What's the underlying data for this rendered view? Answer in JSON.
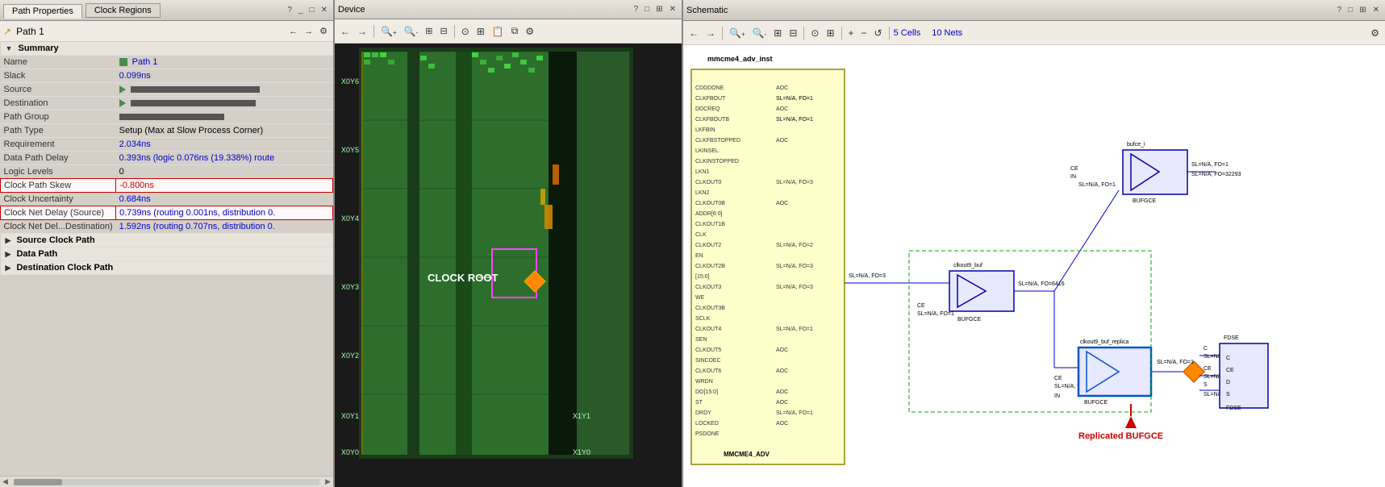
{
  "left_panel": {
    "tab_active": "Path Properties",
    "tab_inactive": "Clock Regions",
    "path_title": "Path 1",
    "toolbar": {
      "back_label": "←",
      "forward_label": "→",
      "settings_label": "⚙"
    },
    "summary_header": "Summary",
    "properties": [
      {
        "key": "Name",
        "value": "Path 1",
        "style": "blue",
        "has_icon": true,
        "highlight": false
      },
      {
        "key": "Slack",
        "value": "0.099ns",
        "style": "blue",
        "highlight": false
      },
      {
        "key": "Source",
        "value": "",
        "style": "bar",
        "highlight": false
      },
      {
        "key": "Destination",
        "value": "",
        "style": "bar",
        "highlight": false
      },
      {
        "key": "Path Group",
        "value": "",
        "style": "bar",
        "highlight": false
      },
      {
        "key": "Path Type",
        "value": "Setup (Max at Slow Process Corner)",
        "style": "black",
        "highlight": false
      },
      {
        "key": "Requirement",
        "value": "2.034ns",
        "style": "blue",
        "highlight": false
      },
      {
        "key": "Data Path Delay",
        "value": "0.393ns (logic 0.076ns (19.338%)  route",
        "style": "blue",
        "highlight": false
      },
      {
        "key": "Logic Levels",
        "value": "0",
        "style": "black",
        "highlight": false
      },
      {
        "key": "Clock Path Skew",
        "value": "-0.800ns",
        "style": "red",
        "highlight": true
      },
      {
        "key": "Clock Uncertainty",
        "value": "0.684ns",
        "style": "blue",
        "highlight": false
      },
      {
        "key": "Clock Net Delay (Source)",
        "value": "0.739ns (routing 0.001ns, distribution 0.",
        "style": "blue",
        "highlight": true
      },
      {
        "key": "Clock Net Del...Destination)",
        "value": "1.592ns (routing 0.707ns, distribution 0.",
        "style": "blue",
        "highlight": false
      }
    ],
    "sections": [
      {
        "label": "Source Clock Path",
        "expanded": false
      },
      {
        "label": "Data Path",
        "expanded": false
      },
      {
        "label": "Destination Clock Path",
        "expanded": false
      }
    ]
  },
  "middle_panel": {
    "title": "Device",
    "toolbar_buttons": [
      "←",
      "→",
      "🔍+",
      "🔍-",
      "⊞",
      "⊟",
      "⊙",
      "⊞",
      "📋",
      "⧉",
      "⚙"
    ],
    "clock_root_label": "CLOCK ROOT",
    "coord_labels": [
      "X0Y6",
      "X0Y5",
      "X0Y4",
      "X0Y3",
      "X0Y2",
      "X0Y1",
      "X0Y0",
      "X1Y1",
      "X1Y0"
    ]
  },
  "right_panel": {
    "title": "Schematic",
    "cell_count": "5 Cells",
    "net_count": "10 Nets",
    "toolbar_buttons": [
      "←",
      "→",
      "🔍+",
      "🔍-",
      "⊞",
      "⊟",
      "⊙",
      "⊞",
      "+",
      "-",
      "↺"
    ],
    "components": {
      "mmcme4_label": "mmcme4_adv_inst",
      "mmcme4_type": "MMCME4_ADV",
      "bufgce1_label": "clkout9_buf",
      "bufgce1_type": "BUFGCE",
      "bufgce2_label": "bufce_i",
      "bufgce2_type": "BUFGCE",
      "bufgce3_label": "clkout9_buf_replica",
      "bufgce3_type": "BUFGCE",
      "fdse_type": "FDSE",
      "replicated_label": "Replicated BUFGCE"
    },
    "mmcme4_ports_left": [
      "CDDDONE",
      "CLKFBOUT",
      "DDCREQ",
      "CLKFBOUTB",
      "LKFBIN",
      "CLKFBSTOPPED",
      "LKINSEL",
      "CLKINSTOPPED",
      "LKN1",
      "CLKOUT0",
      "LKN2",
      "CLKOUT0B",
      "ADDR[6:0]",
      "CLKOUT1B",
      "CLK",
      "CLKOUT2",
      "EN",
      "CLKOUT2B",
      "[15:0]",
      "CLKOUT3",
      "WE",
      "CLKOUT3B",
      "SCLK",
      "CLKOUT4",
      "SEN",
      "CLKOUT5",
      "SINCDEC",
      "CLKOUT6",
      "WRDN",
      "DO[15:0]",
      "ST",
      "DRDY",
      "LOCKED",
      "PSDONE"
    ]
  }
}
